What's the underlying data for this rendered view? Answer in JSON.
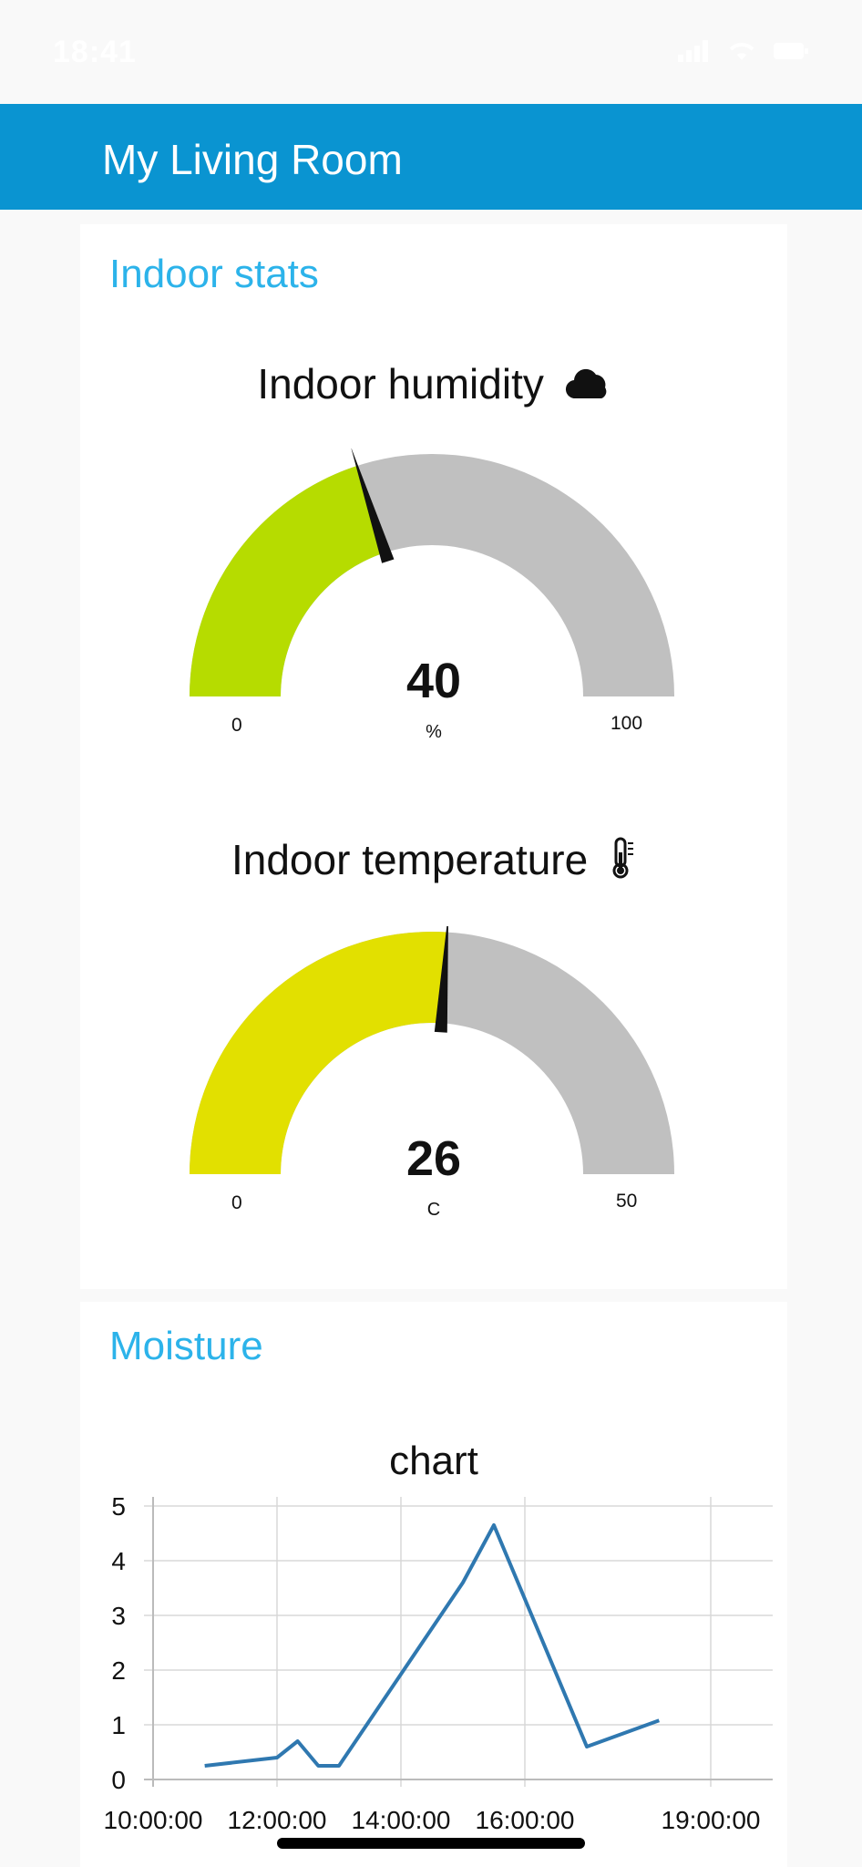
{
  "status_bar": {
    "time": "18:41"
  },
  "header": {
    "title": "My Living Room"
  },
  "indoor_stats": {
    "title": "Indoor stats",
    "humidity": {
      "title": "Indoor humidity",
      "icon": "cloud-icon",
      "value": 40,
      "unit": "%",
      "min": 0,
      "max": 100,
      "fill_color": "#b6dc00",
      "track_color": "#c0c0c0"
    },
    "temperature": {
      "title": "Indoor temperature",
      "icon": "thermometer-icon",
      "value": 26,
      "unit": "C",
      "min": 0,
      "max": 50,
      "fill_color": "#e2e000",
      "track_color": "#c0c0c0"
    }
  },
  "moisture": {
    "title": "Moisture",
    "chart_title": "chart"
  },
  "chart_data": {
    "type": "line",
    "title": "chart",
    "color": "#2f78b0",
    "x": [
      "10:50",
      "12:00",
      "12:20",
      "12:40",
      "13:00",
      "15:00",
      "15:30",
      "17:00",
      "18:10"
    ],
    "y": [
      0.25,
      0.4,
      0.7,
      0.25,
      0.25,
      3.6,
      4.65,
      0.6,
      1.08
    ],
    "xlim": [
      "10:00",
      "20:00"
    ],
    "ylim": [
      0,
      5
    ],
    "yticks": [
      "0",
      "1",
      "2",
      "3",
      "4",
      "5"
    ],
    "xticks": [
      "10:00:00",
      "12:00:00",
      "14:00:00",
      "16:00:00",
      "19:00:00"
    ],
    "grid": true
  }
}
